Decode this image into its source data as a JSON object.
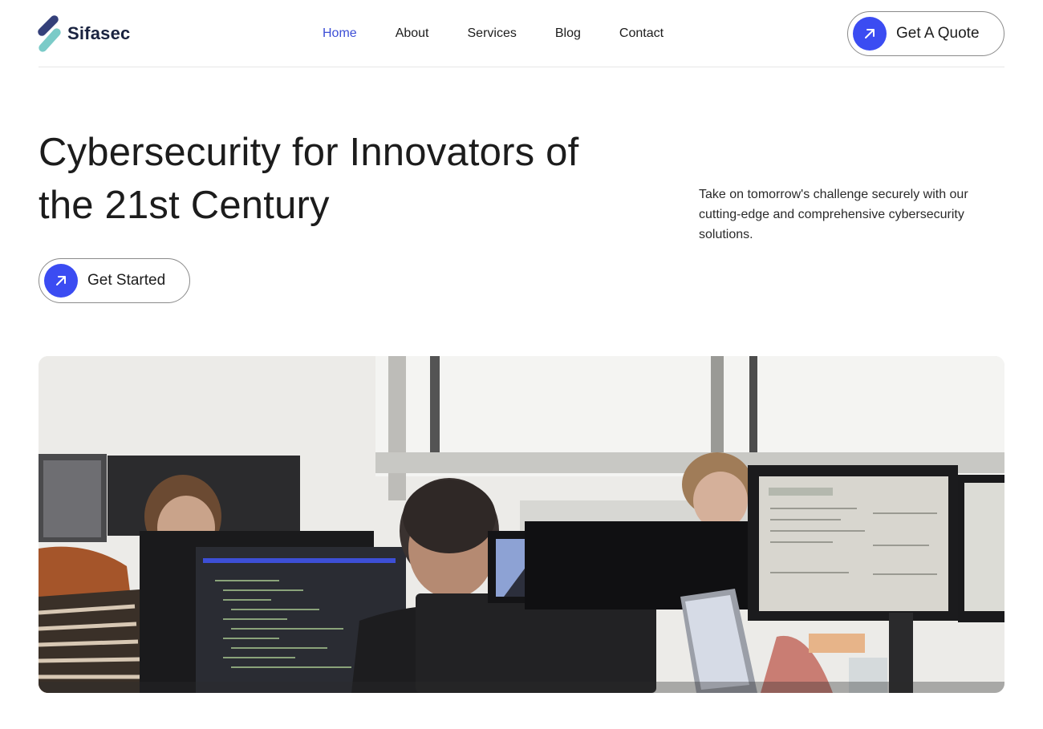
{
  "brand": {
    "name": "Sifasec"
  },
  "nav": {
    "items": [
      {
        "label": "Home",
        "active": true
      },
      {
        "label": "About"
      },
      {
        "label": "Services"
      },
      {
        "label": "Blog"
      },
      {
        "label": "Contact"
      }
    ]
  },
  "header": {
    "quote_label": "Get A Quote"
  },
  "hero": {
    "title_line1": "Cybersecurity for Innovators of",
    "title_line2": "the 21st Century",
    "description": "Take on tomorrow's challenge securely with our cutting-edge and comprehensive cybersecurity solutions.",
    "cta_label": "Get Started"
  },
  "icons": {
    "cta": "arrow-up-right-icon"
  },
  "colors": {
    "accent": "#3b4cf2",
    "nav_active": "#3d4fd6",
    "logo_dark": "#34407a",
    "logo_light": "#7bcbc8"
  }
}
